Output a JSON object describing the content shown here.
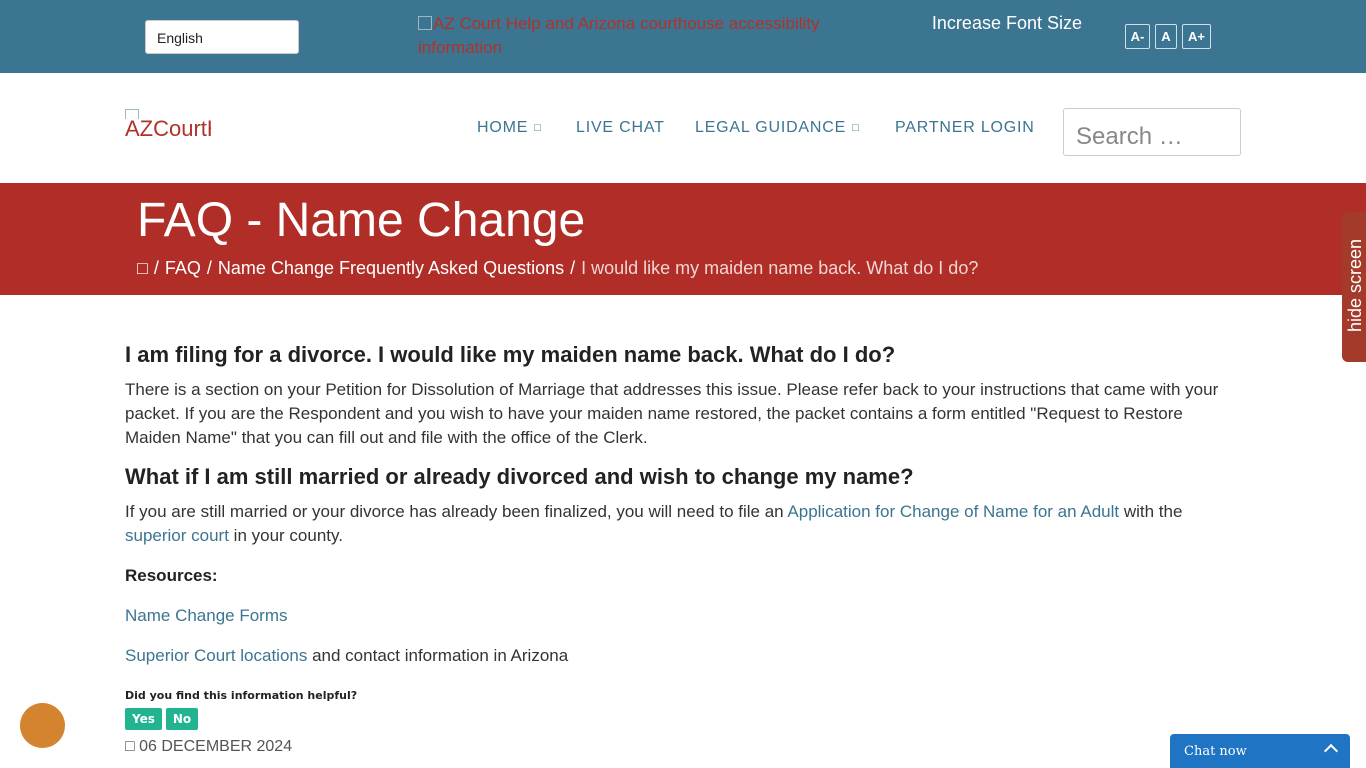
{
  "topbar": {
    "language": "English",
    "access_image_alt": "AZ Court Help and Arizona courthouse accessibility information",
    "font_label": "Increase Font Size",
    "font_buttons": [
      "A-",
      "A",
      "A+"
    ]
  },
  "header": {
    "logo_alt": "AZCourtHelp",
    "nav": [
      {
        "label": "HOME",
        "has_dropdown": true
      },
      {
        "label": "LIVE CHAT",
        "has_dropdown": false
      },
      {
        "label": "LEGAL GUIDANCE",
        "has_dropdown": true
      },
      {
        "label": "PARTNER LOGIN",
        "has_dropdown": false
      }
    ],
    "search_placeholder": "Search …"
  },
  "banner": {
    "title": "FAQ - Name Change",
    "breadcrumbs": {
      "home_icon": "home-icon",
      "items": [
        "FAQ",
        "Name Change Frequently Asked Questions"
      ],
      "current": "I would like my maiden name back. What do I do?"
    }
  },
  "side_tab": {
    "label": "hide screen"
  },
  "content": {
    "q1": {
      "title": "I am filing for a divorce. I would like my maiden name back. What do I do?",
      "body": "There is a section on your Petition for Dissolution of Marriage that addresses this issue. Please refer back to your instructions that came with your packet. If you are the Respondent and you wish to have your maiden name restored, the packet contains a form entitled \"Request to Restore Maiden Name\" that you can fill out and file with the office of the Clerk."
    },
    "q2": {
      "title": "What if I am still married or already divorced and wish to change my name?",
      "body_before": "If you are still married or your divorce has already been finalized, you will need to file an ",
      "link1": "Application for Change of Name for an Adult",
      "body_mid": " with the ",
      "link2": "superior court",
      "body_after": " in your county."
    },
    "resources_label": "Resources:",
    "resource_link1": "Name Change Forms",
    "resource_link2": "Superior Court locations",
    "resource_link2_after": " and contact information in Arizona",
    "helpful_question": "Did you find this information helpful?",
    "yes": "Yes",
    "no": "No",
    "date": "06 DECEMBER 2024"
  },
  "chat": {
    "label": "Chat now"
  },
  "colors": {
    "topbar": "#3b7591",
    "banner": "#b02e27",
    "link": "#3b7591",
    "feedback": "#22b391",
    "chat": "#1f74c3"
  }
}
